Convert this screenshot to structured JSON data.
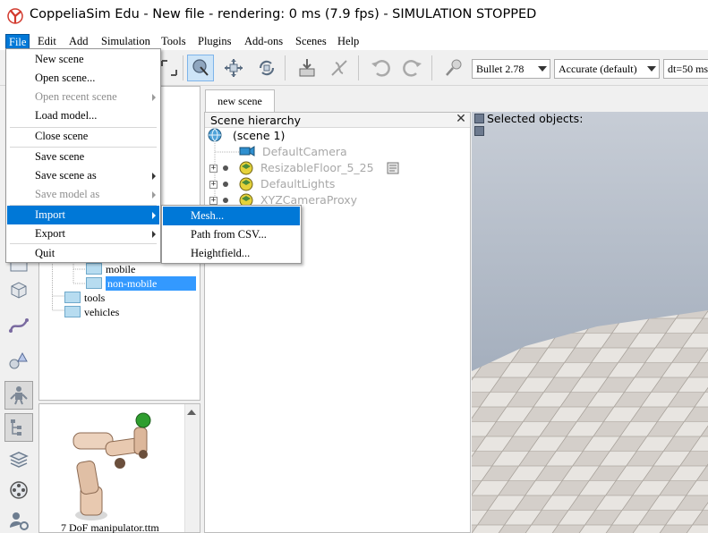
{
  "window": {
    "title": "CoppeliaSim Edu - New file - rendering: 0 ms (7.9 fps) - SIMULATION STOPPED"
  },
  "menubar": {
    "items": [
      "File",
      "Edit",
      "Add",
      "Simulation",
      "Tools",
      "Plugins",
      "Add-ons",
      "Scenes",
      "Help"
    ],
    "active": "File"
  },
  "toolbar": {
    "engine": "Bullet 2.78",
    "accuracy": "Accurate (default)",
    "timestep": "dt=50 ms"
  },
  "file_menu": {
    "items": [
      {
        "label": "New scene",
        "enabled": true
      },
      {
        "label": "Open scene...",
        "enabled": true
      },
      {
        "label": "Open recent scene",
        "enabled": false,
        "submenu": true
      },
      {
        "label": "Load model...",
        "enabled": true
      },
      {
        "label": "Close scene",
        "enabled": true
      },
      {
        "label": "Save scene",
        "enabled": true
      },
      {
        "label": "Save scene as",
        "enabled": true,
        "submenu": true
      },
      {
        "label": "Save model as",
        "enabled": false,
        "submenu": true
      },
      {
        "label": "Import",
        "enabled": true,
        "submenu": true,
        "highlighted": true
      },
      {
        "label": "Export",
        "enabled": true,
        "submenu": true
      },
      {
        "label": "Quit",
        "enabled": true
      }
    ]
  },
  "import_menu": {
    "items": [
      {
        "label": "Mesh...",
        "highlighted": true
      },
      {
        "label": "Path from CSV..."
      },
      {
        "label": "Heightfield..."
      }
    ]
  },
  "model_browser": {
    "folders": [
      {
        "label": "mobile",
        "selected": false
      },
      {
        "label": "non-mobile",
        "selected": true
      },
      {
        "label": "tools",
        "selected": false
      },
      {
        "label": "vehicles",
        "selected": false
      }
    ],
    "preview_caption": "7 DoF manipulator.ttm"
  },
  "scene_tab": {
    "label": "new scene"
  },
  "hierarchy": {
    "title": "Scene hierarchy",
    "close_glyph": "✕",
    "root": "(scene 1)",
    "items": [
      {
        "label": "DefaultCamera",
        "icon": "camera-icon",
        "expandable": false
      },
      {
        "label": "ResizableFloor_5_25",
        "icon": "shape-icon",
        "expandable": true,
        "has_script": true
      },
      {
        "label": "DefaultLights",
        "icon": "light-icon",
        "expandable": true
      },
      {
        "label": "XYZCameraProxy",
        "icon": "dummy-icon",
        "expandable": true
      }
    ]
  },
  "viewport": {
    "selected_label": "Selected objects:",
    "sky_color": "#a9b6c7",
    "floor_colors": [
      "#e6e3df",
      "#d3cec9"
    ]
  },
  "colors": {
    "accent": "#0078d7",
    "selection": "#3399ff"
  }
}
